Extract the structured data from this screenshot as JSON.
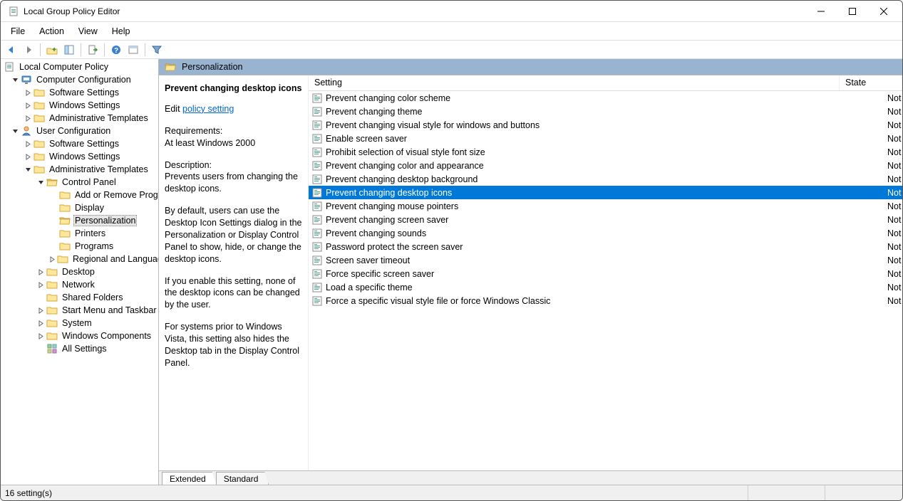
{
  "window": {
    "title": "Local Group Policy Editor"
  },
  "menu": {
    "file": "File",
    "action": "Action",
    "view": "View",
    "help": "Help"
  },
  "tree": {
    "root": "Local Computer Policy",
    "computer_config": "Computer Configuration",
    "cc_software": "Software Settings",
    "cc_windows": "Windows Settings",
    "cc_admin": "Administrative Templates",
    "user_config": "User Configuration",
    "uc_software": "Software Settings",
    "uc_windows": "Windows Settings",
    "uc_admin": "Administrative Templates",
    "control_panel": "Control Panel",
    "cp_addremove": "Add or Remove Programs",
    "cp_display": "Display",
    "cp_personalization": "Personalization",
    "cp_printers": "Printers",
    "cp_programs": "Programs",
    "cp_regional": "Regional and Language Options",
    "desktop": "Desktop",
    "network": "Network",
    "shared_folders": "Shared Folders",
    "start_menu": "Start Menu and Taskbar",
    "system": "System",
    "windows_components": "Windows Components",
    "all_settings": "All Settings"
  },
  "header": {
    "title": "Personalization"
  },
  "description": {
    "selected_title": "Prevent changing desktop icons",
    "edit_prefix": "Edit ",
    "edit_link": "policy setting ",
    "req_label": "Requirements:",
    "req_value": "At least Windows 2000",
    "desc_label": "Description:",
    "p1": "Prevents users from changing the desktop icons.",
    "p2": "By default, users can use the Desktop Icon Settings dialog in the Personalization or Display Control Panel to show, hide, or change the desktop icons.",
    "p3": "If you enable this setting, none of the desktop icons can be changed by the user.",
    "p4": "For systems prior to Windows Vista, this setting also hides the Desktop tab in the Display Control Panel."
  },
  "columns": {
    "setting": "Setting",
    "state": "State"
  },
  "settings": [
    {
      "name": "Prevent changing color scheme",
      "state": "Not configured"
    },
    {
      "name": "Prevent changing theme",
      "state": "Not configured"
    },
    {
      "name": "Prevent changing visual style for windows and buttons",
      "state": "Not configured"
    },
    {
      "name": "Enable screen saver",
      "state": "Not configured"
    },
    {
      "name": "Prohibit selection of visual style font size",
      "state": "Not configured"
    },
    {
      "name": "Prevent changing color and appearance",
      "state": "Not configured"
    },
    {
      "name": "Prevent changing desktop background",
      "state": "Not configured"
    },
    {
      "name": "Prevent changing desktop icons",
      "state": "Not configured"
    },
    {
      "name": "Prevent changing mouse pointers",
      "state": "Not configured"
    },
    {
      "name": "Prevent changing screen saver",
      "state": "Not configured"
    },
    {
      "name": "Prevent changing sounds",
      "state": "Not configured"
    },
    {
      "name": "Password protect the screen saver",
      "state": "Not configured"
    },
    {
      "name": "Screen saver timeout",
      "state": "Not configured"
    },
    {
      "name": "Force specific screen saver",
      "state": "Not configured"
    },
    {
      "name": "Load a specific theme",
      "state": "Not configured"
    },
    {
      "name": "Force a specific visual style file or force Windows Classic",
      "state": "Not configured"
    }
  ],
  "tabs": {
    "extended": "Extended",
    "standard": "Standard"
  },
  "status": {
    "text": "16 setting(s)"
  }
}
